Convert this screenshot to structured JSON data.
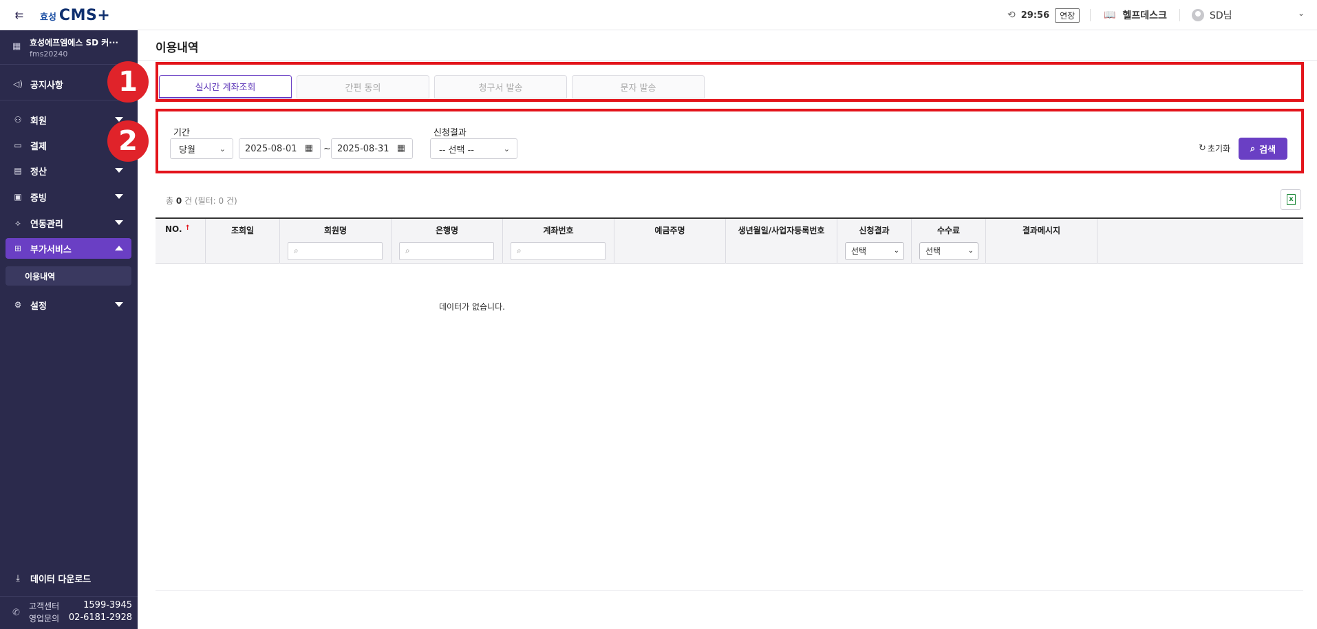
{
  "header": {
    "logo_prefix": "효성",
    "logo_main": "CMS",
    "logo_suffix": "+",
    "session_timer": "29:56",
    "extend_label": "연장",
    "helpdesk_label": "헬프데스크",
    "user_name": "SD님"
  },
  "sidebar": {
    "company_name": "효성에프엠에스 SD 커···",
    "company_id": "fms20240",
    "items": [
      {
        "label": "공지사항"
      },
      {
        "label": "회원"
      },
      {
        "label": "결제"
      },
      {
        "label": "정산"
      },
      {
        "label": "증빙"
      },
      {
        "label": "연동관리"
      },
      {
        "label": "부가서비스"
      },
      {
        "label": "설정"
      }
    ],
    "sub_item": "이용내역",
    "download_label": "데이터 다운로드",
    "contact": {
      "cs_label": "고객센터",
      "cs_phone": "1599-3945",
      "sales_label": "영업문의",
      "sales_phone": "02-6181-2928"
    }
  },
  "main": {
    "title": "이용내역",
    "annotations": {
      "badge1": "1",
      "badge2": "2"
    },
    "tabs": [
      {
        "label": "실시간 계좌조회",
        "active": true
      },
      {
        "label": "간편 동의",
        "active": false
      },
      {
        "label": "청구서 발송",
        "active": false
      },
      {
        "label": "문자 발송",
        "active": false
      }
    ],
    "filters": {
      "period_label": "기간",
      "period_value": "당월",
      "start_date": "2025-08-01",
      "tilde": "~",
      "end_date": "2025-08-31",
      "result_label": "신청결과",
      "result_value": "-- 선택 --",
      "reset_label": "초기화",
      "search_label": "검색"
    },
    "summary": {
      "prefix": "총",
      "count": "0",
      "suffix": "건 (필터: 0 건)"
    },
    "table": {
      "columns": [
        "NO.",
        "조회일",
        "회원명",
        "은행명",
        "계좌번호",
        "예금주명",
        "생년월일/사업자등록번호",
        "신청결과",
        "수수료",
        "결과메시지"
      ],
      "select_placeholder": "선택",
      "empty_message": "데이터가 없습니다."
    }
  },
  "colors": {
    "sidebar_bg": "#2b2a4c",
    "accent": "#6a3fc4",
    "annotation_red": "#e3141b"
  }
}
